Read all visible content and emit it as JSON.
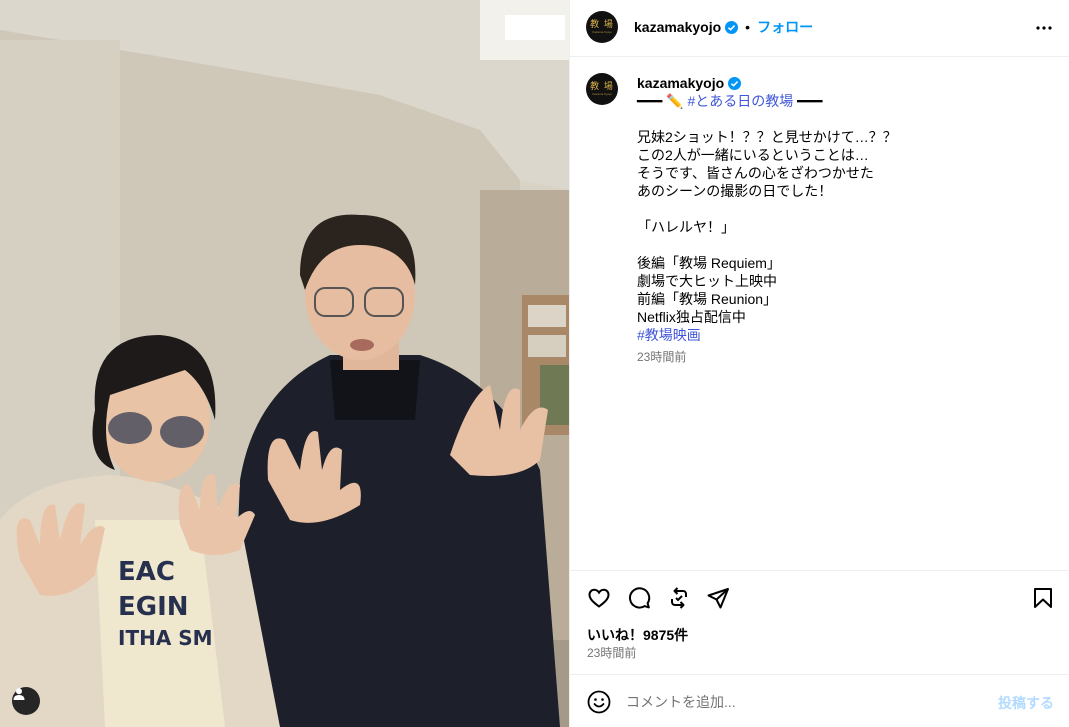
{
  "account": {
    "username": "kazamakyojo",
    "follow_label": "フォロー",
    "separator": "•",
    "avatar_kanji": "教 場",
    "avatar_sub": "Kazama Kyojo"
  },
  "caption": {
    "lines": [
      {
        "prefix": "━━━ ✏️ ",
        "tag": "#とある日の教場",
        "suffix": " ━━━"
      },
      {
        "text": ""
      },
      {
        "text": "兄妹2ショット！？？と見せかけて…？？"
      },
      {
        "text": "この2人が一緒にいるということは…"
      },
      {
        "text": "そうです、皆さんの心をざわつかせた"
      },
      {
        "text": "あのシーンの撮影の日でした！"
      },
      {
        "text": ""
      },
      {
        "text": "「ハレルヤ！」"
      },
      {
        "text": ""
      },
      {
        "text": "後編「教場 Requiem」"
      },
      {
        "text": "劇場で大ヒット上映中"
      },
      {
        "text": "前編「教場 Reunion」"
      },
      {
        "text": "Netflix独占配信中"
      }
    ],
    "hashtag": "#教場映画",
    "time": "23時間前"
  },
  "actions": {
    "like": "heart-icon",
    "comment": "comment-icon",
    "repost": "repost-icon",
    "share": "share-icon",
    "save": "bookmark-icon"
  },
  "likes_label": "いいね！9875件",
  "post_time": "23時間前",
  "comment": {
    "placeholder": "コメントを追加...",
    "post_label": "投稿する"
  },
  "colors": {
    "accent": "#0095f6",
    "hashtag": "#4056d8",
    "post_disabled": "#b3dbff"
  }
}
